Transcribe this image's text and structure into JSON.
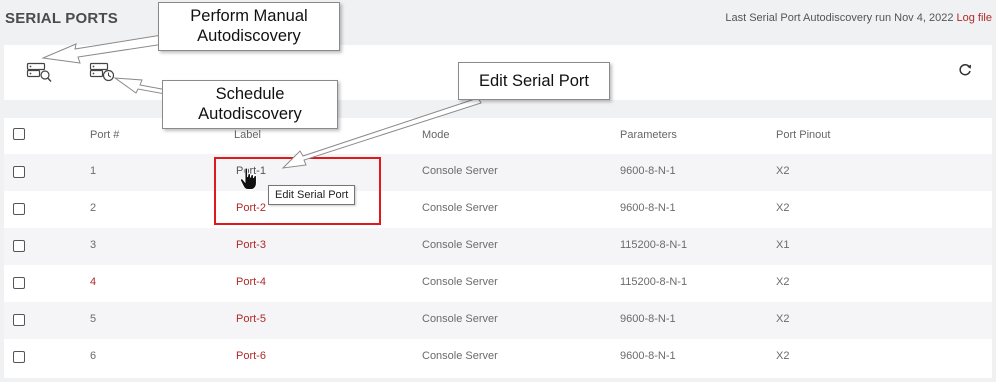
{
  "header": {
    "title": "SERIAL PORTS",
    "autodiscovery_text": "Last Serial Port Autodiscovery run Nov 4, 2022",
    "log_link": "Log file"
  },
  "toolbar": {
    "manual_autodiscovery_icon": "server-search-icon",
    "schedule_autodiscovery_icon": "server-clock-icon",
    "refresh_icon": "refresh-icon"
  },
  "table": {
    "columns": [
      "Port #",
      "Label",
      "Mode",
      "Parameters",
      "Port Pinout"
    ],
    "rows": [
      {
        "port": "1",
        "label": "Port-1",
        "mode": "Console Server",
        "parameters": "9600-8-N-1",
        "pinout": "X2"
      },
      {
        "port": "2",
        "label": "Port-2",
        "mode": "Console Server",
        "parameters": "9600-8-N-1",
        "pinout": "X2"
      },
      {
        "port": "3",
        "label": "Port-3",
        "mode": "Console Server",
        "parameters": "115200-8-N-1",
        "pinout": "X1"
      },
      {
        "port": "4",
        "label": "Port-4",
        "mode": "Console Server",
        "parameters": "115200-8-N-1",
        "pinout": "X2"
      },
      {
        "port": "5",
        "label": "Port-5",
        "mode": "Console Server",
        "parameters": "9600-8-N-1",
        "pinout": "X2"
      },
      {
        "port": "6",
        "label": "Port-6",
        "mode": "Console Server",
        "parameters": "9600-8-N-1",
        "pinout": "X2"
      }
    ]
  },
  "tooltip": "Edit Serial Port",
  "callouts": {
    "manual": [
      "Perform Manual",
      "Autodiscovery"
    ],
    "schedule": [
      "Schedule",
      "Autodiscovery"
    ],
    "edit": [
      "Edit Serial Port"
    ]
  },
  "colors": {
    "link_red": "#b02a2a",
    "highlight_red": "#e0191c"
  }
}
